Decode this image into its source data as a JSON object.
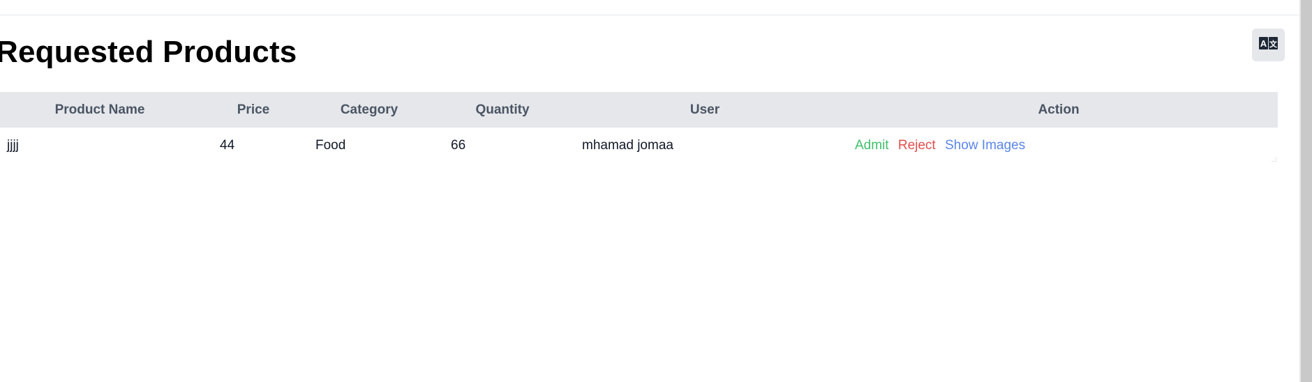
{
  "page": {
    "title": "Requested Products"
  },
  "header_bar": {
    "translate_icon": "translate-icon"
  },
  "table": {
    "columns": [
      "Product Name",
      "Price",
      "Category",
      "Quantity",
      "User",
      "Action"
    ],
    "rows": [
      {
        "product_name": "jjjj",
        "price": "44",
        "category": "Food",
        "quantity": "66",
        "user": "mhamad jomaa",
        "actions": {
          "admit": "Admit",
          "reject": "Reject",
          "show_images": "Show Images"
        }
      }
    ]
  },
  "colors": {
    "admit": "#3fbf6a",
    "reject": "#e24d4d",
    "show_images": "#5a86e8",
    "header_bg": "#e5e7eb"
  }
}
